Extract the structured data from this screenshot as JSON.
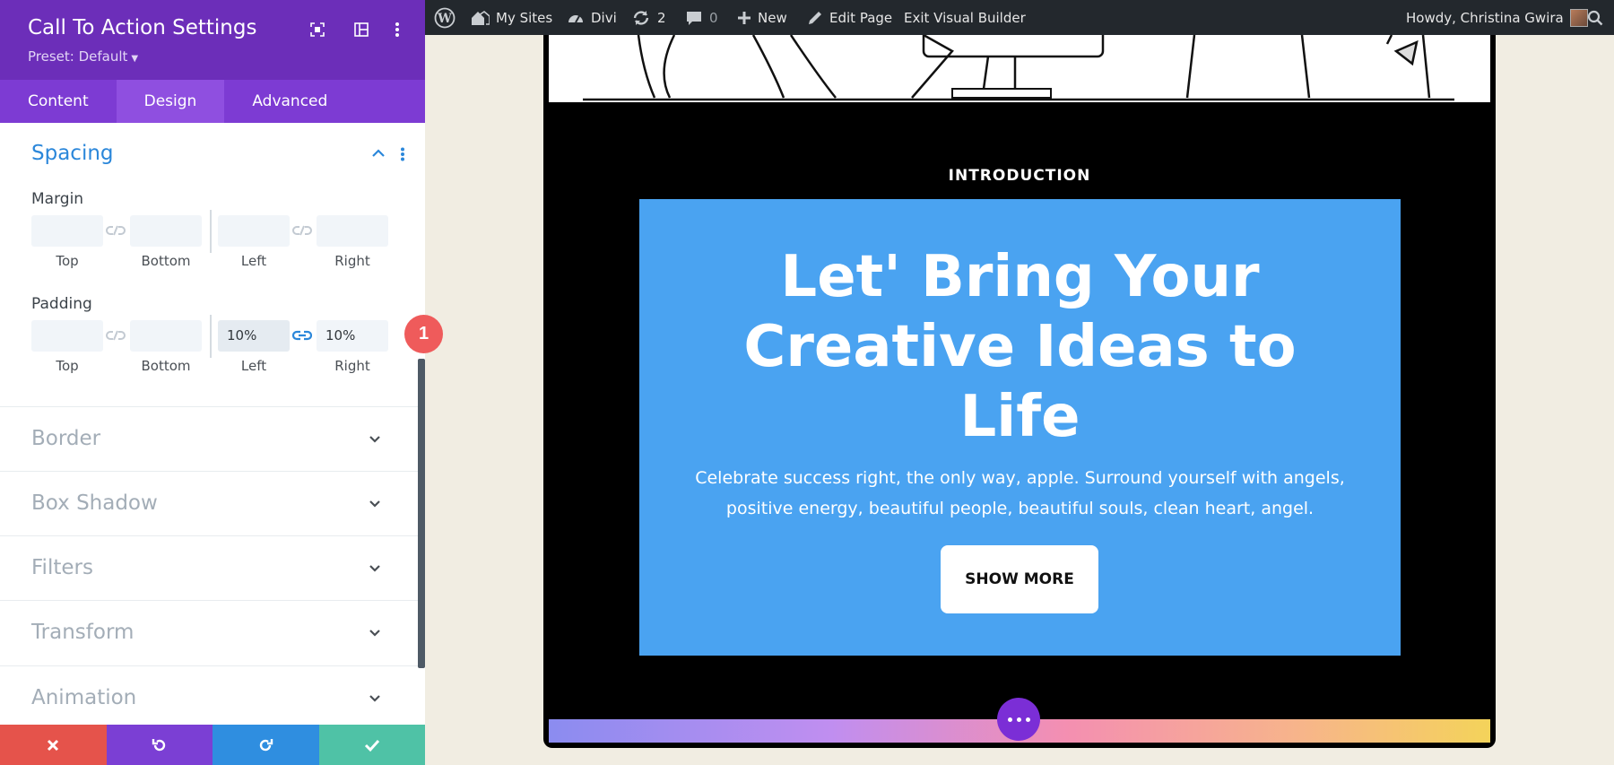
{
  "panel": {
    "title": "Call To Action Settings",
    "preset": "Preset: Default",
    "tabs": [
      {
        "label": "Content"
      },
      {
        "label": "Design"
      },
      {
        "label": "Advanced"
      }
    ]
  },
  "spacing": {
    "title": "Spacing",
    "margin": {
      "label": "Margin",
      "fields": [
        {
          "label": "Top",
          "value": ""
        },
        {
          "label": "Bottom",
          "value": ""
        },
        {
          "label": "Left",
          "value": ""
        },
        {
          "label": "Right",
          "value": ""
        }
      ]
    },
    "padding": {
      "label": "Padding",
      "fields": [
        {
          "label": "Top",
          "value": ""
        },
        {
          "label": "Bottom",
          "value": ""
        },
        {
          "label": "Left",
          "value": "10%"
        },
        {
          "label": "Right",
          "value": "10%"
        }
      ]
    }
  },
  "collapsed_sections": [
    {
      "title": "Border"
    },
    {
      "title": "Box Shadow"
    },
    {
      "title": "Filters"
    },
    {
      "title": "Transform"
    },
    {
      "title": "Animation"
    }
  ],
  "step_badge": "1",
  "adminbar": {
    "my_sites": "My Sites",
    "divi": "Divi",
    "updates": "2",
    "comments": "0",
    "new": "New",
    "edit_page": "Edit Page",
    "exit_builder": "Exit Visual Builder",
    "howdy": "Howdy, Christina Gwira"
  },
  "preview": {
    "intro": "INTRODUCTION",
    "title_lines": [
      "Let' Bring Your",
      "Creative Ideas to",
      "Life"
    ],
    "body_lines": [
      "Celebrate success right, the only way, apple. Surround yourself with angels,",
      "positive energy, beautiful people, beautiful souls, clean heart, angel."
    ],
    "button": "SHOW MORE"
  },
  "colors": {
    "panel_header": "#6c2eb9",
    "tab_bar": "#7d3bd3",
    "active_tab": "#8f4fe0",
    "section_open": "#2b87da",
    "cta_background": "#4aa3f1",
    "discard": "#e5534b",
    "undo": "#7b3fd4",
    "redo": "#2f8ee0",
    "save": "#4fc2a6",
    "badge": "#ef5b5b"
  }
}
